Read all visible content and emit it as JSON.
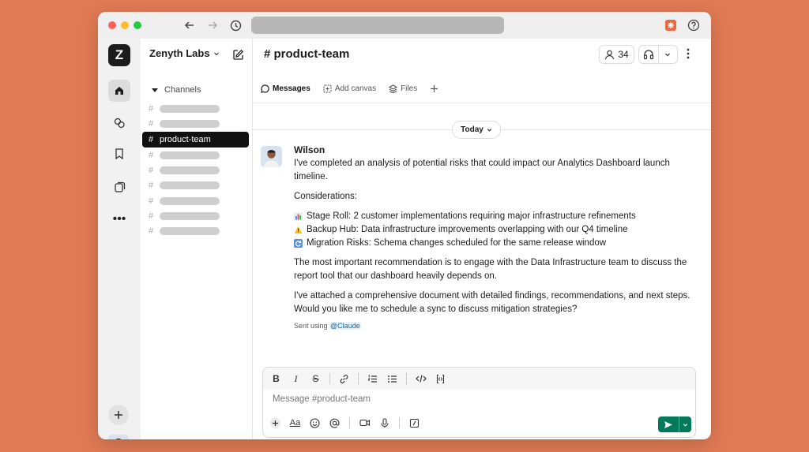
{
  "workspace": {
    "name": "Zenyth Labs",
    "logo_letter": "Z"
  },
  "sidebar": {
    "section_label": "Channels",
    "channels": [
      {
        "label": "",
        "active": false
      },
      {
        "label": "",
        "active": false
      },
      {
        "label": "product-team",
        "active": true
      },
      {
        "label": "",
        "active": false
      },
      {
        "label": "",
        "active": false
      },
      {
        "label": "",
        "active": false
      },
      {
        "label": "",
        "active": false
      },
      {
        "label": "",
        "active": false
      },
      {
        "label": "",
        "active": false
      }
    ]
  },
  "channel": {
    "name": "# product-team",
    "member_count": "34"
  },
  "tabs": [
    {
      "label": "Messages",
      "active": true
    },
    {
      "label": "Add canvas",
      "active": false
    },
    {
      "label": "Files",
      "active": false
    }
  ],
  "day_divider": "Today",
  "message": {
    "author": "Wilson",
    "intro": "I've completed an analysis of potential risks that could impact our Analytics Dashboard launch timeline.",
    "considerations_label": "Considerations:",
    "items": [
      {
        "icon": "bar-chart-icon",
        "text": "Stage Roll: 2 customer implementations requiring major infrastructure refinements"
      },
      {
        "icon": "warning-icon",
        "text": "Backup Hub: Data infrastructure improvements overlapping with our Q4 timeline"
      },
      {
        "icon": "refresh-icon",
        "text": "Migration Risks: Schema changes scheduled for the same release window"
      }
    ],
    "recommendation": "The most important recommendation is to engage with the Data Infrastructure team to discuss the report tool that our dashboard heavily depends on.",
    "closing": "I've attached a comprehensive document with detailed findings, recommendations, and next steps. Would you like me to schedule a sync to discuss mitigation strategies?",
    "sent_prefix": "Sent using",
    "sent_mention": "@Claude"
  },
  "composer": {
    "placeholder": "Message #product-team"
  },
  "colors": {
    "accent_send": "#007a5a",
    "background": "#e07a54",
    "active_channel": "#111111"
  }
}
